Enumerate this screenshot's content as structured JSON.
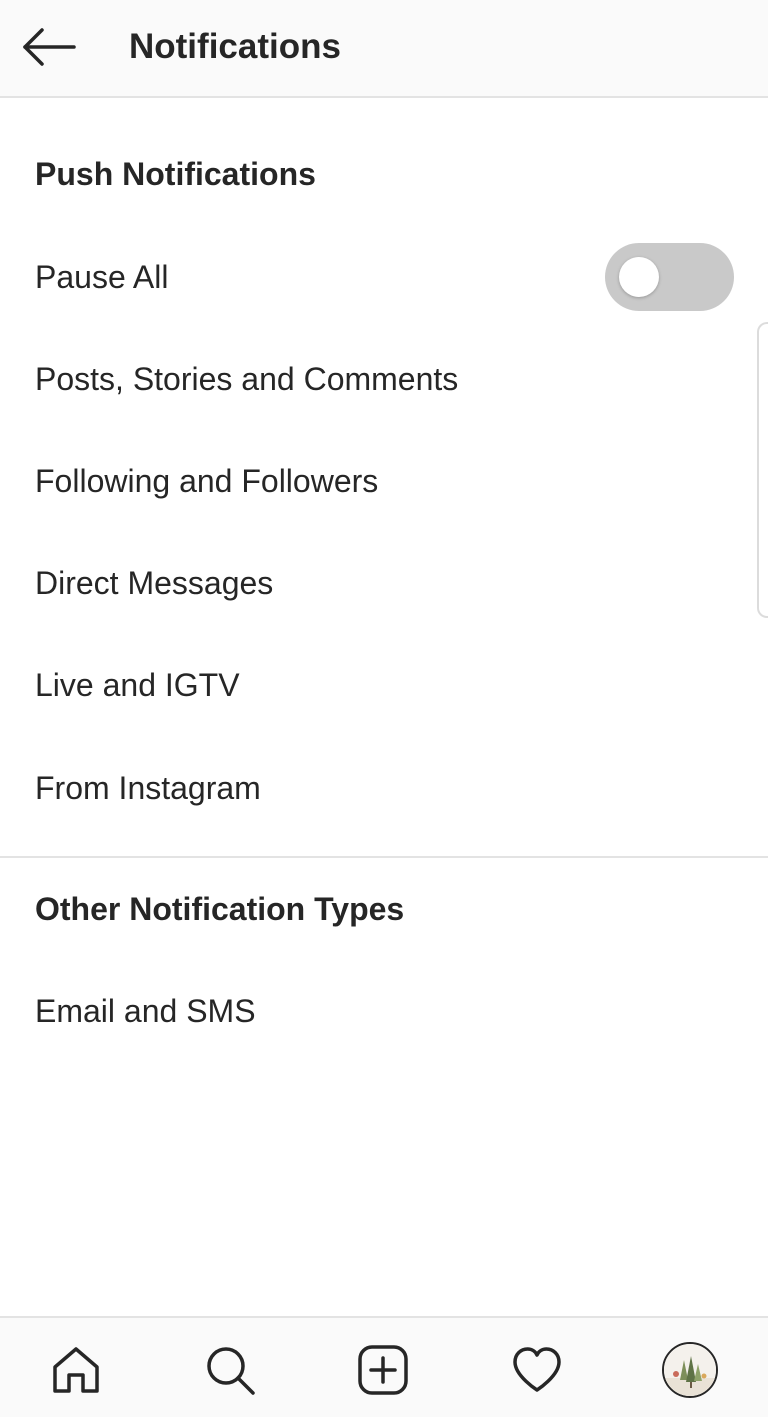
{
  "header": {
    "title": "Notifications",
    "back_icon": "arrow-left-icon"
  },
  "push_section": {
    "heading": "Push Notifications",
    "pause_all": {
      "label": "Pause All",
      "toggle_on": false
    },
    "items": [
      {
        "label": "Posts, Stories and Comments"
      },
      {
        "label": "Following and Followers"
      },
      {
        "label": "Direct Messages"
      },
      {
        "label": "Live and IGTV"
      },
      {
        "label": "From Instagram"
      }
    ]
  },
  "other_section": {
    "heading": "Other Notification Types",
    "items": [
      {
        "label": "Email and SMS"
      }
    ]
  },
  "bottom_nav": {
    "items": [
      "home-icon",
      "search-icon",
      "new-post-icon",
      "activity-heart-icon",
      "profile-avatar"
    ]
  },
  "colors": {
    "text": "#262626",
    "header_bg": "#fafafa",
    "divider": "#e3e3e3",
    "toggle_off": "#c9c9c9"
  }
}
